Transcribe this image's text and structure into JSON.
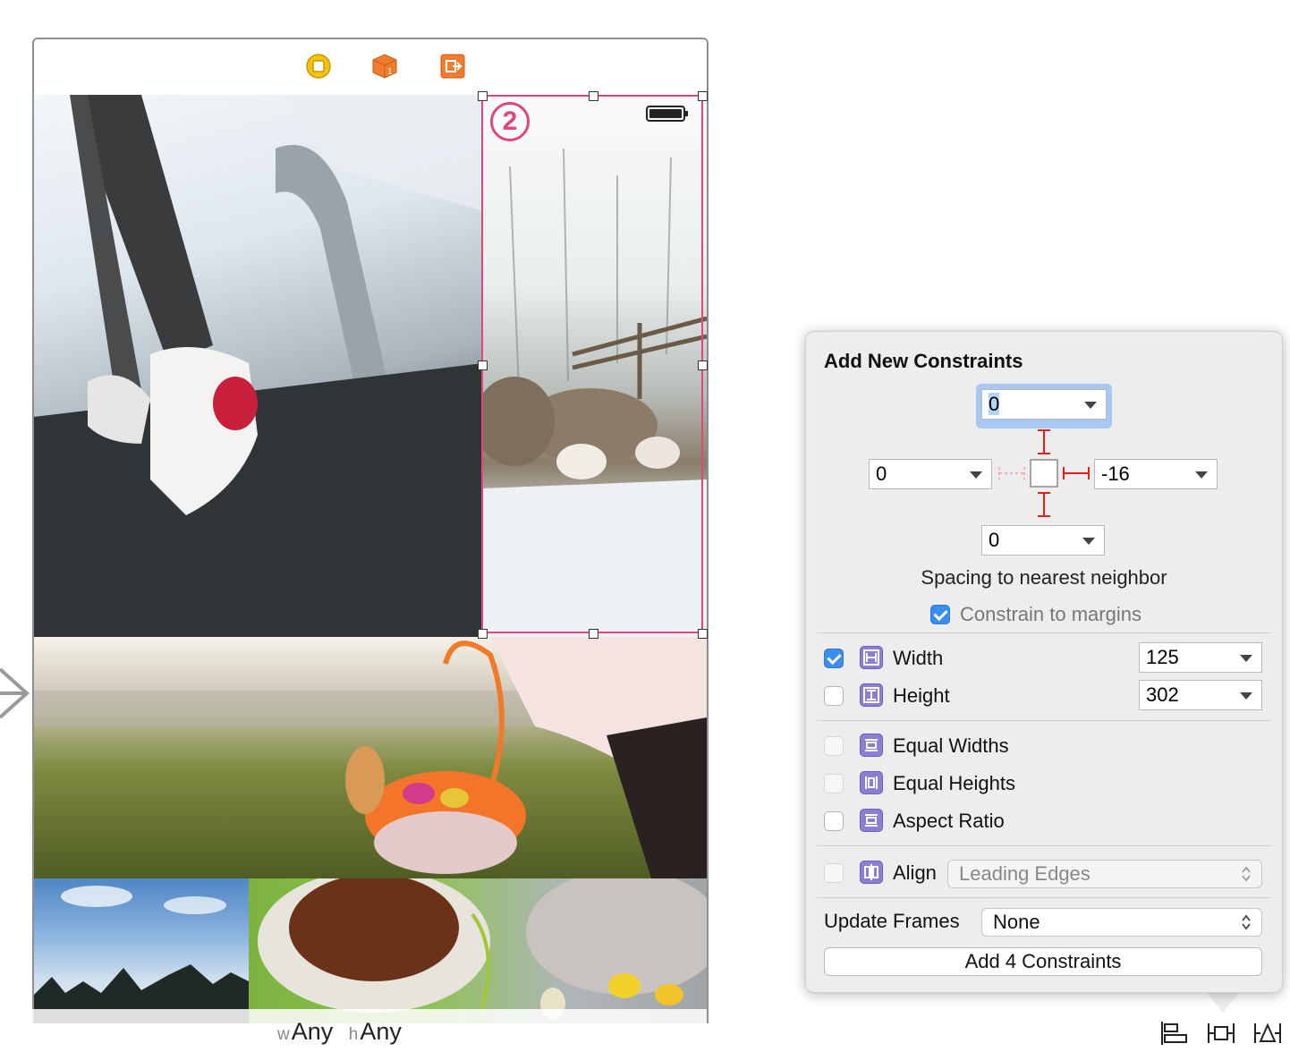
{
  "canvas": {
    "size_class": {
      "w_prefix": "w",
      "w_value": "Any",
      "h_prefix": "h",
      "h_value": "Any"
    },
    "scene": {
      "dock_icons": [
        "view-controller-icon",
        "first-responder-icon",
        "exit-icon"
      ],
      "selected_badge": "2",
      "images": [
        "treadmill-photo",
        "sheep-photo",
        "easter-basket-photo",
        "sky-trees-photo",
        "easter-cake-photo"
      ]
    }
  },
  "popover": {
    "title": "Add New Constraints",
    "spacing": {
      "top": "0",
      "left": "0",
      "right": "-16",
      "bottom": "0",
      "label": "Spacing to nearest neighbor",
      "constrain_to_margins": {
        "label": "Constrain to margins",
        "checked": true
      }
    },
    "size": {
      "width": {
        "label": "Width",
        "value": "125",
        "checked": true
      },
      "height": {
        "label": "Height",
        "value": "302",
        "checked": false
      }
    },
    "equal": {
      "equal_widths": {
        "label": "Equal Widths",
        "checked": false
      },
      "equal_heights": {
        "label": "Equal Heights",
        "checked": false
      },
      "aspect_ratio": {
        "label": "Aspect Ratio",
        "checked": false
      }
    },
    "align": {
      "label": "Align",
      "value": "Leading Edges",
      "checked": false,
      "enabled": false
    },
    "update_frames": {
      "label": "Update Frames",
      "value": "None"
    },
    "add_button": "Add 4 Constraints"
  },
  "toolbar": {
    "icons": [
      "align-icon",
      "pin-icon",
      "resolve-issues-icon"
    ]
  },
  "colors": {
    "selection": "#e0457b",
    "constraint": "#e0201e",
    "accent": "#3b8df2",
    "focus": "#a6c8f2"
  }
}
